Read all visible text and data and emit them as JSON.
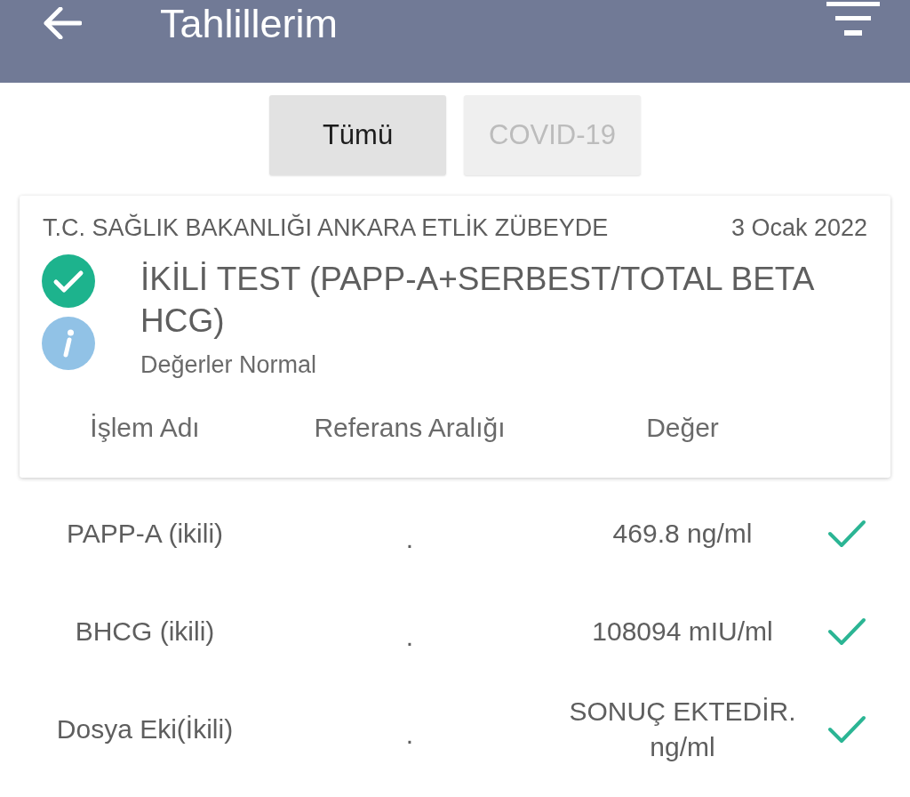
{
  "header": {
    "title": "Tahlillerim"
  },
  "tabs": [
    {
      "label": "Tümü",
      "selected": true
    },
    {
      "label": "COVID-19",
      "selected": false
    }
  ],
  "result_card": {
    "institution": "T.C. SAĞLIK BAKANLIĞI ANKARA ETLİK ZÜBEYDE",
    "date": "3 Ocak 2022",
    "normal": true,
    "test_name": "İKİLİ TEST (PAPP-A+SERBEST/TOTAL BETA HCG)",
    "status": "Değerler Normal",
    "columns": [
      "İşlem Adı",
      "Referans Aralığı",
      "Değer"
    ]
  },
  "results": [
    {
      "name": "PAPP-A (ikili)",
      "reference": ".",
      "value": "469.8 ng/ml",
      "normal": true
    },
    {
      "name": "BHCG (ikili)",
      "reference": ".",
      "value": "108094 mIU/ml",
      "normal": true
    },
    {
      "name": "Dosya Eki(İkili)",
      "reference": ".",
      "value": "SONUÇ EKTEDİR. ng/ml",
      "normal": true
    }
  ]
}
